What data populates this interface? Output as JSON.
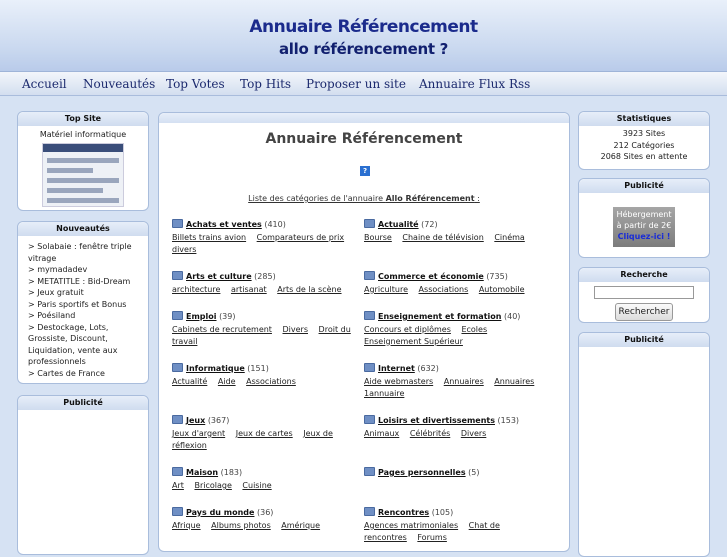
{
  "header": {
    "title1": "Annuaire Référencement",
    "title2": "allo référencement ?"
  },
  "nav": [
    "Accueil",
    "Nouveautés",
    "Top Votes",
    "Top Hits",
    "Proposer un site",
    "Annuaire Flux Rss"
  ],
  "left": {
    "topsite": {
      "title": "Top Site",
      "caption": "Matériel informatique"
    },
    "nouveautes": {
      "title": "Nouveautés",
      "items": [
        "> Solabaie : fenêtre triple vitrage",
        "> mymadadev",
        "> METATITLE : Bid-Dream",
        "> Jeux gratuit",
        "> Paris sportifs et Bonus",
        "> Poésiland",
        "> Destockage, Lots, Grossiste, Discount, Liquidation, vente aux professionnels",
        "> Cartes de France"
      ]
    },
    "publicite": {
      "title": "Publicité"
    }
  },
  "main": {
    "title": "Annuaire Référencement",
    "help_icon": "?",
    "intro_prefix": "Liste des catégories de l'annuaire ",
    "intro_bold": "Allo Référencement",
    "intro_suffix": " :",
    "categories": [
      {
        "name": "Achats et ventes",
        "count": "(410)",
        "subs": [
          "Billets trains avion",
          "Comparateurs de prix",
          "divers"
        ]
      },
      {
        "name": "Actualité",
        "count": "(72)",
        "subs": [
          "Bourse",
          "Chaine de télévision",
          "Cinéma"
        ]
      },
      {
        "name": "Arts et culture",
        "count": "(285)",
        "subs": [
          "architecture",
          "artisanat",
          "Arts de la scène"
        ]
      },
      {
        "name": "Commerce et économie",
        "count": "(735)",
        "subs": [
          "Agriculture",
          "Associations",
          "Automobile"
        ]
      },
      {
        "name": "Emploi",
        "count": "(39)",
        "subs": [
          "Cabinets de recrutement",
          "Divers",
          "Droit du travail"
        ]
      },
      {
        "name": "Enseignement et formation",
        "count": "(40)",
        "subs": [
          "Concours et diplômes",
          "Ecoles",
          "Enseignement Supérieur"
        ]
      },
      {
        "name": "Informatique",
        "count": "(151)",
        "subs": [
          "Actualité",
          "Aide",
          "Associations"
        ]
      },
      {
        "name": "Internet",
        "count": "(632)",
        "subs": [
          "Aide webmasters",
          "Annuaires",
          "Annuaires 1annuaire"
        ]
      },
      {
        "name": "Jeux",
        "count": "(367)",
        "subs": [
          "Jeux d'argent",
          "Jeux de cartes",
          "Jeux de réflexion"
        ]
      },
      {
        "name": "Loisirs et divertissements",
        "count": "(153)",
        "subs": [
          "Animaux",
          "Célébrités",
          "Divers"
        ]
      },
      {
        "name": "Maison",
        "count": "(183)",
        "subs": [
          "Art",
          "Bricolage",
          "Cuisine"
        ]
      },
      {
        "name": "Pages personnelles",
        "count": "(5)",
        "subs": []
      },
      {
        "name": "Pays du monde",
        "count": "(36)",
        "subs": [
          "Afrique",
          "Albums photos",
          "Amérique"
        ]
      },
      {
        "name": "Rencontres",
        "count": "(105)",
        "subs": [
          "Agences matrimoniales",
          "Chat de rencontres",
          "Forums"
        ]
      }
    ]
  },
  "right": {
    "stats": {
      "title": "Statistiques",
      "sites": "3923 Sites",
      "categories": "212 Catégories",
      "pending": "2068 Sites en attente"
    },
    "publicite1": {
      "title": "Publicité",
      "ad_line1": "Hébergement",
      "ad_line2": "à partir de 2€",
      "ad_line3": "Cliquez-ici !"
    },
    "recherche": {
      "title": "Recherche",
      "button": "Rechercher"
    },
    "publicite2": {
      "title": "Publicité"
    }
  }
}
